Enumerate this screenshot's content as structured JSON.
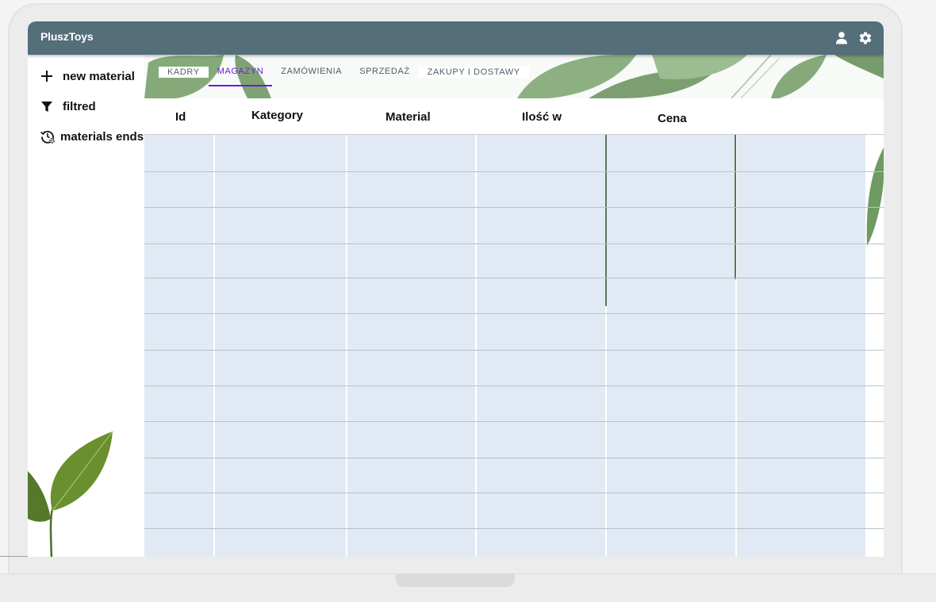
{
  "app": {
    "brand": "PluszToys",
    "icons": [
      "user-icon",
      "gear-icon"
    ]
  },
  "sidebar": {
    "items": [
      {
        "label": "new material",
        "icon": "plus-icon"
      },
      {
        "label": "filtred",
        "icon": "filter-icon"
      },
      {
        "label": "materials ends",
        "icon": "history-settings-icon"
      }
    ]
  },
  "tabs": [
    {
      "label": "KADRY",
      "active": false
    },
    {
      "label": "MAGAZYN",
      "active": true
    },
    {
      "label": "ZAMÓWIENIA",
      "active": false
    },
    {
      "label": "SPRZEDAŻ",
      "active": false
    },
    {
      "label": "ZAKUPY I DOSTAWY",
      "active": false
    }
  ],
  "table": {
    "headers": [
      "Id",
      "Kategory",
      "Material",
      "Ilość w",
      "Cena"
    ],
    "rows": []
  },
  "colors": {
    "appbar": "#546e7a",
    "accent": "#6a1be0",
    "cell_bg": "#e1eaf4"
  }
}
